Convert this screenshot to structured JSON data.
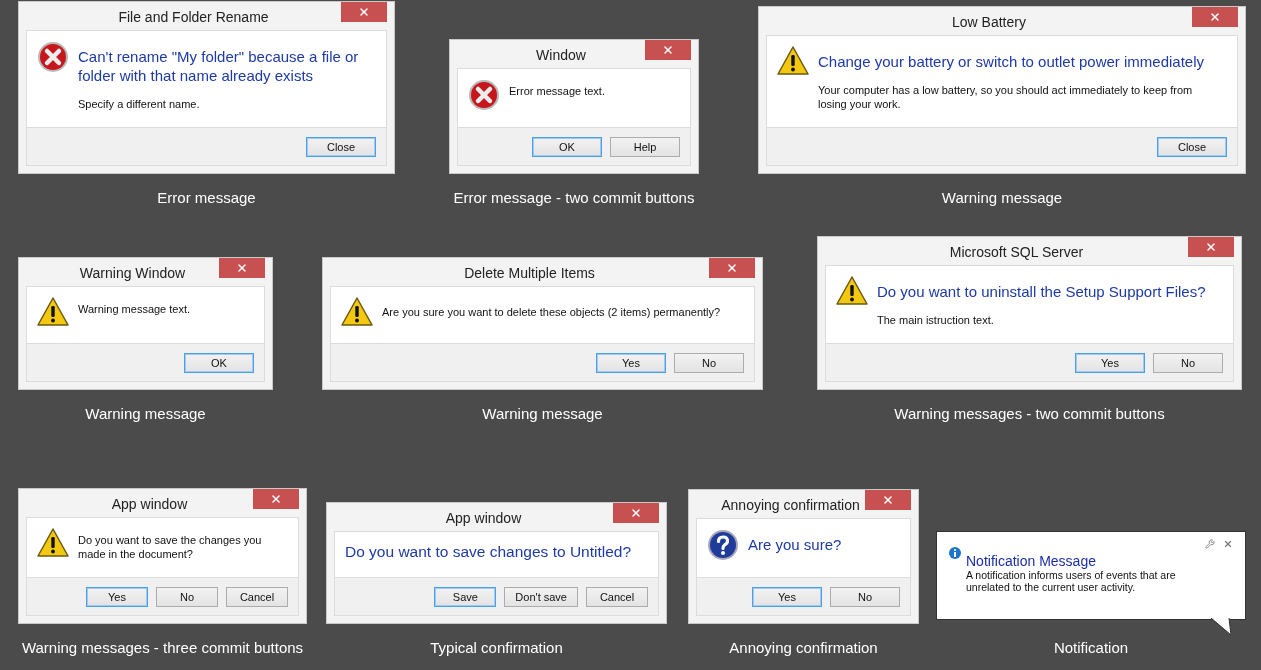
{
  "rows": [
    [
      {
        "kind": "error",
        "title": "File and Folder Rename",
        "main": "Can't rename \"My folder\" because a file or folder with that name already exists",
        "content": "Specify a different name.",
        "buttons": [
          {
            "label": "Close",
            "selected": true
          }
        ],
        "caption": "Error message"
      },
      {
        "kind": "error",
        "title": "Window",
        "content": "Error message text.",
        "buttons": [
          {
            "label": "OK",
            "selected": true
          },
          {
            "label": "Help",
            "selected": false
          }
        ],
        "caption": "Error message - two commit buttons"
      },
      {
        "kind": "warning",
        "title": "Low Battery",
        "main": "Change your battery or switch to outlet power immediately",
        "content": "Your computer has a low battery, so you should act immediately to keep from losing your work.",
        "buttons": [
          {
            "label": "Close",
            "selected": true
          }
        ],
        "caption": "Warning message"
      }
    ],
    [
      {
        "kind": "warning",
        "title": "Warning Window",
        "content": "Warning message text.",
        "buttons": [
          {
            "label": "OK",
            "selected": true
          }
        ],
        "caption": "Warning message"
      },
      {
        "kind": "warning",
        "title": "Delete Multiple Items",
        "content": "Are you sure you want to delete these objects (2 items) permanently?",
        "buttons": [
          {
            "label": "Yes",
            "selected": true
          },
          {
            "label": "No",
            "selected": false
          }
        ],
        "caption": "Warning message"
      },
      {
        "kind": "warning",
        "title": "Microsoft SQL Server",
        "main": "Do you want to uninstall the Setup Support Files?",
        "content": "The main istruction text.",
        "buttons": [
          {
            "label": "Yes",
            "selected": true
          },
          {
            "label": "No",
            "selected": false
          }
        ],
        "caption": "Warning messages - two commit buttons"
      }
    ],
    [
      {
        "kind": "warning",
        "title": "App window",
        "content": "Do you want to save the changes you made in the document?",
        "buttons": [
          {
            "label": "Yes",
            "selected": true
          },
          {
            "label": "No",
            "selected": false
          },
          {
            "label": "Cancel",
            "selected": false
          }
        ],
        "caption": "Warning messages - three commit buttons"
      },
      {
        "kind": "plain",
        "title": "App window",
        "main": "Do you want to save changes to Untitled?",
        "buttons": [
          {
            "label": "Save",
            "selected": true
          },
          {
            "label": "Don't save",
            "selected": false
          },
          {
            "label": "Cancel",
            "selected": false
          }
        ],
        "caption": "Typical confirmation"
      },
      {
        "kind": "question",
        "title": "Annoying confirmation",
        "main": "Are you sure?",
        "buttons": [
          {
            "label": "Yes",
            "selected": true
          },
          {
            "label": "No",
            "selected": false
          }
        ],
        "caption": "Annoying confirmation"
      },
      {
        "kind": "notification",
        "title": "Notification Message",
        "content": "A notification informs users of events that are unrelated to the current user activity.",
        "caption": "Notification"
      }
    ]
  ]
}
